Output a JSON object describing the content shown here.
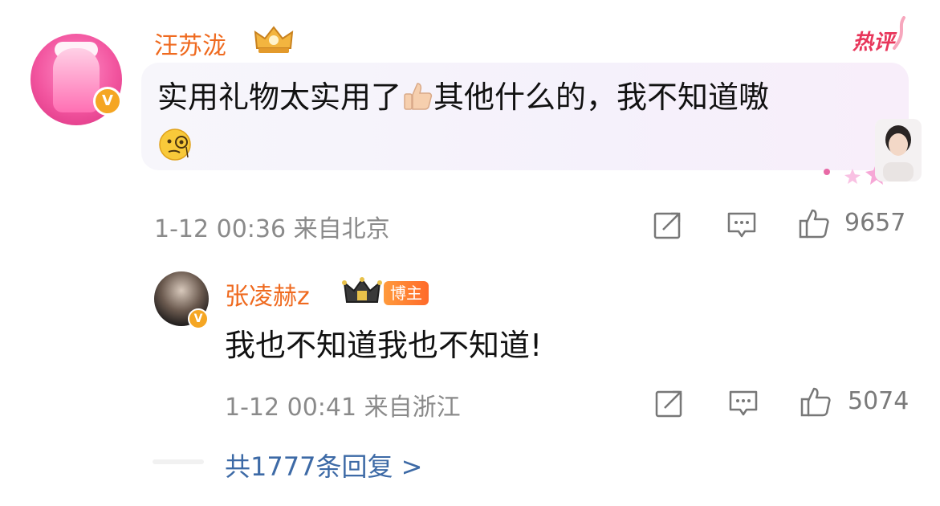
{
  "comment": {
    "username": "汪苏泷",
    "hot_tag": "热评",
    "verified_mark": "V",
    "text_before_emoji": "实用礼物太实用了",
    "text_after_emoji": "其他什么的，我不知道嗷",
    "inline_emojis": [
      "thumbs-up-icon",
      "face-with-monocle-icon"
    ],
    "meta": "1-12 00:36 来自北京",
    "like_count": "9657"
  },
  "reply": {
    "username": "张凌赫z",
    "badge": "博主",
    "verified_mark": "V",
    "text": "我也不知道我也不知道!",
    "meta": "1-12 00:41 来自浙江",
    "like_count": "5074"
  },
  "footer": {
    "total_replies": "共1777条回复 >"
  },
  "colors": {
    "username": "#ef6a1f",
    "link": "#3d6aa6",
    "meta": "#8a8a8a",
    "hot": "#e8355a",
    "verified": "#f5a623"
  }
}
